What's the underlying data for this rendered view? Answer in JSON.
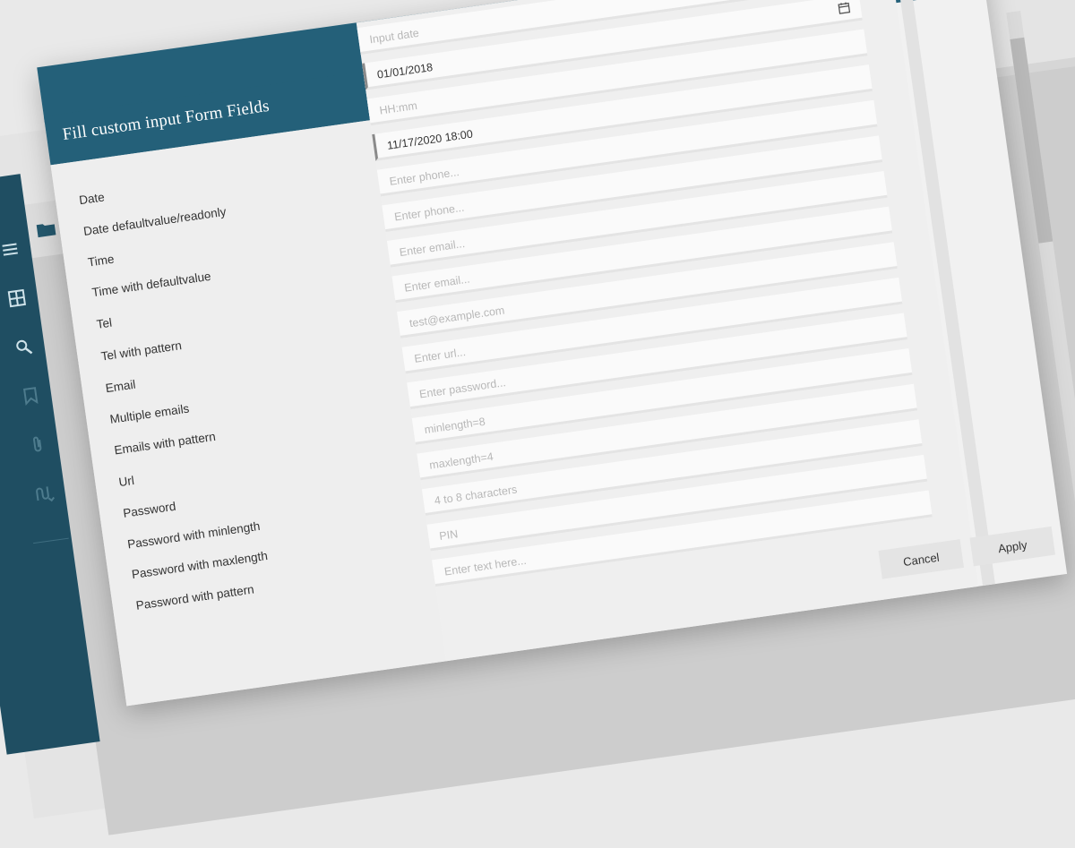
{
  "dialog": {
    "title": "Fill custom input Form Fields",
    "cancel_label": "Cancel",
    "apply_label": "Apply"
  },
  "fields": [
    {
      "label": "Date",
      "value": "",
      "placeholder": "Input date",
      "calendar": true
    },
    {
      "label": "Date defaultvalue/readonly",
      "value": "01/01/2018",
      "placeholder": "",
      "calendar": true
    },
    {
      "label": "Time",
      "value": "",
      "placeholder": "HH:mm"
    },
    {
      "label": "Time with defaultvalue",
      "value": "11/17/2020 18:00",
      "placeholder": ""
    },
    {
      "label": "Tel",
      "value": "",
      "placeholder": "Enter phone..."
    },
    {
      "label": "Tel with pattern",
      "value": "",
      "placeholder": "Enter phone..."
    },
    {
      "label": "Email",
      "value": "",
      "placeholder": "Enter email..."
    },
    {
      "label": "Multiple emails",
      "value": "",
      "placeholder": "Enter email..."
    },
    {
      "label": "Emails with pattern",
      "value": "",
      "placeholder": "test@example.com"
    },
    {
      "label": "Url",
      "value": "",
      "placeholder": "Enter url..."
    },
    {
      "label": "Password",
      "value": "",
      "placeholder": "Enter password..."
    },
    {
      "label": "Password with minlength",
      "value": "",
      "placeholder": "minlength=8"
    },
    {
      "label": "Password with maxlength",
      "value": "",
      "placeholder": "maxlength=4"
    },
    {
      "label": "Password with pattern",
      "value": "",
      "placeholder": "4 to 8 characters"
    },
    {
      "label": "",
      "value": "",
      "placeholder": "PIN"
    },
    {
      "label": "",
      "value": "",
      "placeholder": "Enter text here..."
    }
  ],
  "sidebar": {
    "icons": [
      "menu-icon",
      "grid-icon",
      "search-icon",
      "bookmark-icon",
      "paperclip-icon",
      "signature-icon"
    ]
  },
  "colors": {
    "accent": "#246079",
    "rail": "#1f4e62"
  }
}
